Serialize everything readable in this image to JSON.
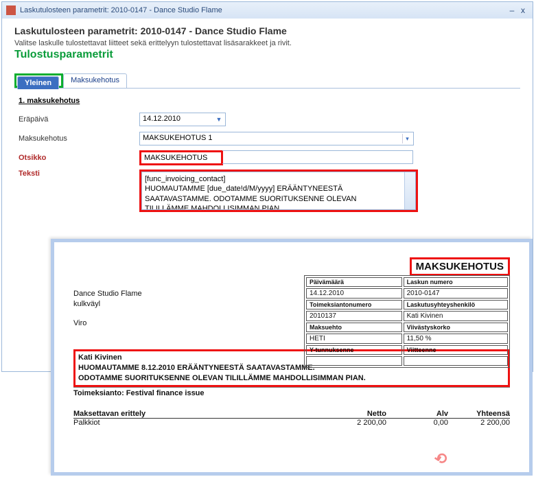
{
  "window": {
    "title": "Laskutulosteen parametrit: 2010-0147 - Dance Studio Flame",
    "minimize": "–",
    "close": "x"
  },
  "page": {
    "heading": "Laskutulosteen parametrit: 2010-0147 - Dance Studio Flame",
    "sub": "Valitse laskulle tulostettavat liitteet sekä erittelyyn tulostettavat lisäsarakkeet ja rivit.",
    "greenlabel": "Tulostusparametrit"
  },
  "tabs": {
    "general": "Yleinen",
    "reminder": "Maksukehotus"
  },
  "form": {
    "section": "1. maksukehotus",
    "due_label": "Eräpäivä",
    "due_value": "14.12.2010",
    "reminder_label": "Maksukehotus",
    "reminder_value": "MAKSUKEHOTUS 1",
    "title_label": "Otsikko",
    "title_value": "MAKSUKEHOTUS",
    "text_label": "Teksti",
    "text_value": "[func_invoicing_contact]\nHUOMAUTAMME [due_date!d/M/yyyy] ERÄÄNTYNEESTÄ SAATAVASTAMME. ODOTAMME SUORITUKSENNE OLEVAN TILILLÄMME MAHDOLLISIMMAN PIAN."
  },
  "preview": {
    "doctitle": "MAKSUKEHOTUS",
    "company": "Dance Studio Flame",
    "street": "kulkväyl",
    "country": "Viro",
    "info": {
      "date_h": "Päivämäärä",
      "date_v": "14.12.2010",
      "invno_h": "Laskun numero",
      "invno_v": "2010-0147",
      "assign_h": "Toimeksiantonumero",
      "assign_v": "2010137",
      "contact_h": "Laskutusyhteyshenkilö",
      "contact_v": "Kati Kivinen",
      "term_h": "Maksuehto",
      "term_v": "HETI",
      "interest_h": "Viivästyskorko",
      "interest_v": "11,50 %",
      "vat_h": "Y-tunnuksenne",
      "vat_v": "",
      "ref_h": "Viitteenne",
      "ref_v": ""
    },
    "notice": {
      "name": "Kati Kivinen",
      "line1": "HUOMAUTAMME 8.12.2010 ERÄÄNTYNEESTÄ SAATAVASTAMME.",
      "line2": "ODOTAMME SUORITUKSENNE OLEVAN TILILLÄMME MAHDOLLISIMMAN PIAN."
    },
    "assignment": "Toimeksianto: Festival finance issue",
    "grid": {
      "h": "Maksettavan erittely",
      "net": "Netto",
      "vat": "Alv",
      "total": "Yhteensä",
      "row_label": "Palkkiot",
      "row_net": "2 200,00",
      "row_vat": "0,00",
      "row_total": "2 200,00"
    }
  }
}
